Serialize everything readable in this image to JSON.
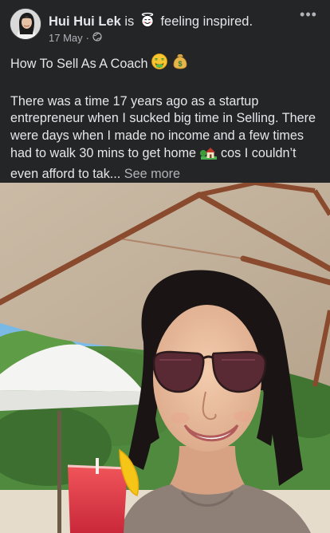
{
  "post": {
    "author": "Hui Hui Lek",
    "verb": "is",
    "feeling": "feeling inspired.",
    "feeling_icon": "smiling-face-with-halo-icon",
    "timestamp": "17 May",
    "separator": "·",
    "privacy_icon": "globe-icon",
    "more_label": "•••",
    "title": "How To Sell As A Coach",
    "title_emojis": [
      "money-mouth-face-icon",
      "money-bag-icon"
    ],
    "body_part1": "There was a time 17 years ago as a startup entrepreneur when I sucked big time in Selling. There were days when I made no income and a few times had to walk 30 mins to get home",
    "body_emoji": "house-with-garden-icon",
    "body_part2": " cos I couldn’t even afford to tak...",
    "see_more": "See more"
  },
  "colors": {
    "background": "#242526",
    "primary_text": "#e4e6eb",
    "secondary_text": "#b0b3b8"
  }
}
